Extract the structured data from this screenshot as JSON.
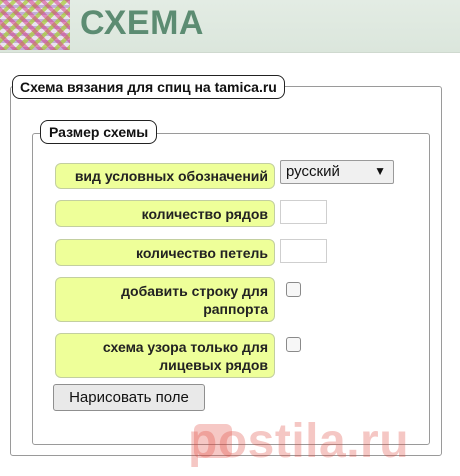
{
  "header": {
    "title": "СХЕМА",
    "logo_icon": "knitting-pattern-logo"
  },
  "form": {
    "outer_legend": "Схема вязания для спиц на tamica.ru",
    "inner_legend": "Размер схемы",
    "rows": [
      {
        "label": "вид условных обозначений",
        "control": "select",
        "value": "русский"
      },
      {
        "label": "количество рядов",
        "control": "text",
        "value": ""
      },
      {
        "label": "количество петель",
        "control": "text",
        "value": ""
      },
      {
        "label": [
          "добавить строку для",
          "раппорта"
        ],
        "control": "checkbox",
        "checked": false
      },
      {
        "label": [
          "схема узора только для",
          "лицевых рядов"
        ],
        "control": "checkbox",
        "checked": false
      }
    ],
    "submit_label": "Нарисовать поле"
  },
  "watermark": {
    "text": "postila.ru",
    "color": "#e0493e"
  },
  "colors": {
    "title": "#5c8c72",
    "label_bg": "#eeff99",
    "header_bg": "#dfe9e0"
  }
}
